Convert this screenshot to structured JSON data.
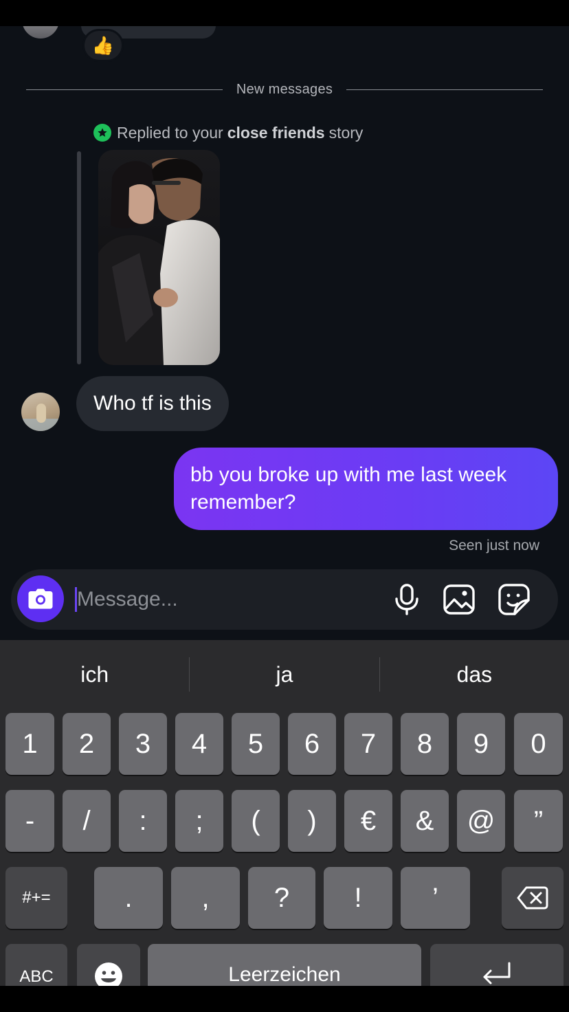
{
  "thread": {
    "previous_reaction": "👍",
    "divider_label": "New messages",
    "reply_note": {
      "prefix": "Replied to your",
      "emphasis": "close friends",
      "suffix": "story"
    },
    "incoming_message": "Who tf is this",
    "outgoing_message": "bb you broke up with me last week remember?",
    "seen_status": "Seen just now"
  },
  "composer": {
    "placeholder": "Message...",
    "icons": [
      "camera-icon",
      "microphone-icon",
      "gallery-icon",
      "sticker-icon"
    ]
  },
  "keyboard": {
    "suggestions": [
      "ich",
      "ja",
      "das"
    ],
    "row1": [
      "1",
      "2",
      "3",
      "4",
      "5",
      "6",
      "7",
      "8",
      "9",
      "0"
    ],
    "row2": [
      "-",
      "/",
      ":",
      ";",
      "(",
      ")",
      "€",
      "&",
      "@",
      "”"
    ],
    "row3": {
      "shift_label": "#+=",
      "keys": [
        ".",
        ",",
        "?",
        "!",
        "’"
      ],
      "delete_icon": "backspace-icon"
    },
    "row4": {
      "abc_label": "ABC",
      "emoji_icon": "emoji-icon",
      "space_label": "Leerzeichen",
      "return_icon": "return-icon"
    }
  },
  "colors": {
    "background": "#0d1117",
    "incoming_bubble": "#262a31",
    "outgoing_bubble": "#6a3cf4",
    "camera_button": "#5e2ff2",
    "close_friends_star": "#1ec15a",
    "keyboard_bg": "#2b2b2d",
    "key_bg": "#6b6b6f"
  }
}
